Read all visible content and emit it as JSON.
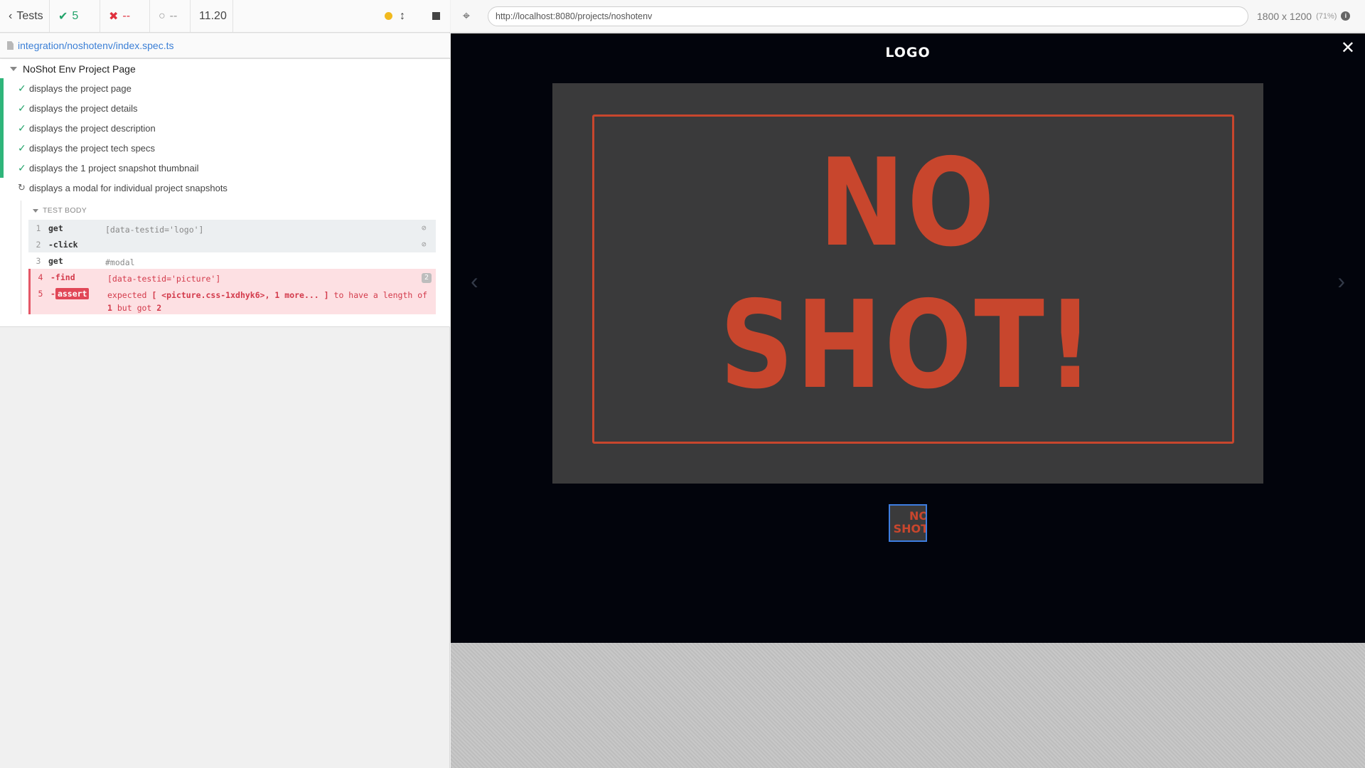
{
  "runner": {
    "back_label": "Tests",
    "passed_count": "5",
    "failed_count": "--",
    "pending_count": "--",
    "duration": "11.20",
    "spec_path": "integration/noshotenv/index.spec.ts",
    "suite_title": "NoShot Env Project Page",
    "tests": [
      {
        "title": "displays the project page",
        "state": "passed"
      },
      {
        "title": "displays the project details",
        "state": "passed"
      },
      {
        "title": "displays the project description",
        "state": "passed"
      },
      {
        "title": "displays the project tech specs",
        "state": "passed"
      },
      {
        "title": "displays the 1 project snapshot thumbnail",
        "state": "passed"
      },
      {
        "title": "displays a modal for individual project snapshots",
        "state": "running"
      }
    ],
    "test_body_label": "TEST BODY",
    "commands": [
      {
        "num": "1",
        "name": "get",
        "msg": "[data-testid='logo']"
      },
      {
        "num": "2",
        "name": "-click",
        "msg": ""
      },
      {
        "num": "3",
        "name": "get",
        "msg": "#modal"
      },
      {
        "num": "4",
        "name": "-find",
        "msg": "[data-testid='picture']",
        "count": "2"
      },
      {
        "num": "5",
        "name": "-",
        "badge": "assert",
        "msg_prefix": "expected",
        "msg_subject": "[ <picture.css-1xdhyk6>, 1 more... ]",
        "msg_mid": "to have a length of",
        "msg_expected": "1",
        "msg_but": "but got",
        "msg_actual": "2"
      }
    ]
  },
  "aut": {
    "url": "http://localhost:8080/projects/noshotenv",
    "viewport": "1800 x 1200",
    "scale": "(71%)",
    "logo": "LOGO",
    "close": "✕",
    "snapshot_line1": "NO",
    "snapshot_line2": "SHOT!",
    "thumb_line1": "NO",
    "thumb_line2": "SHOT"
  },
  "colors": {
    "pass": "#22a36a",
    "fail": "#e0303d",
    "accent_link": "#3b7fd6",
    "brand_orange": "#c8462d",
    "modal_bg": "#02040c"
  }
}
